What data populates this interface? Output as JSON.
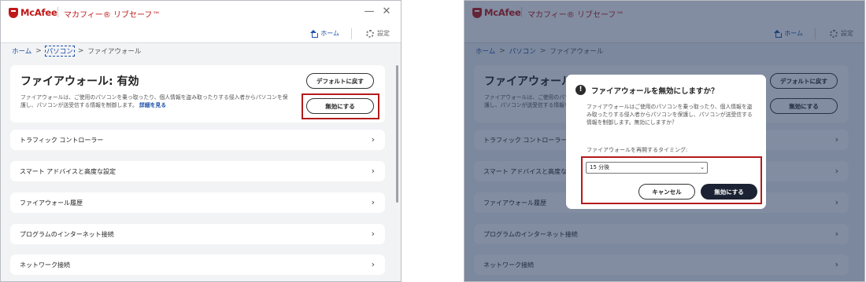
{
  "app": {
    "brand": "McAfee",
    "title": "マカフィー® リブセーフ™"
  },
  "window": {
    "minimize": "—",
    "close": "✕"
  },
  "toolbar": {
    "home": "ホーム",
    "settings": "設定"
  },
  "breadcrumb": {
    "home": "ホーム",
    "sep1": ">",
    "pc": "パソコン",
    "sep2": ">",
    "current": "ファイアウォール"
  },
  "firewall": {
    "title": "ファイアウォール: 有効",
    "description": "ファイアウォールは、ご使用のパソコンを乗っ取ったり、個人情報を盗み取ったりする侵入者からパソコンを保護し、パソコンが送受信する情報を制御します。",
    "detail_link": "詳細を見る",
    "default_button": "デフォルトに戻す",
    "disable_button": "無効にする"
  },
  "menu": {
    "items": [
      {
        "label": "トラフィック コントローラー",
        "chevron": "›"
      },
      {
        "label": "スマート アドバイスと高度な設定",
        "chevron": "›"
      },
      {
        "label": "ファイアウォール履歴",
        "chevron": "›"
      },
      {
        "label": "プログラムのインターネット接続",
        "chevron": "›"
      },
      {
        "label": "ネットワーク接続",
        "chevron": "›"
      }
    ]
  },
  "dialog": {
    "icon": "!",
    "title": "ファイアウォールを無効にしますか？",
    "body": "ファイアウォールはご使用のパソコンを乗っ取ったり、個人情報を盗み取ったりする侵入者からパソコンを保護し、パソコンが送受信する情報を制御します。無効にしますか？",
    "timing_label": "ファイアウォールを再開するタイミング:",
    "select_value": "15 分後",
    "cancel": "キャンセル",
    "confirm": "無効にする"
  },
  "colors": {
    "brand_red": "#c01818",
    "link_blue": "#1c4fa8",
    "highlight": "#b31b1b",
    "overlay": "#1c2f54",
    "confirm_bg": "#1b2233"
  },
  "icons": {
    "home": "home-icon",
    "settings": "gear-icon",
    "alert": "alert-icon",
    "chevron": "chevron-right-icon",
    "shield": "mcafee-shield-icon"
  }
}
